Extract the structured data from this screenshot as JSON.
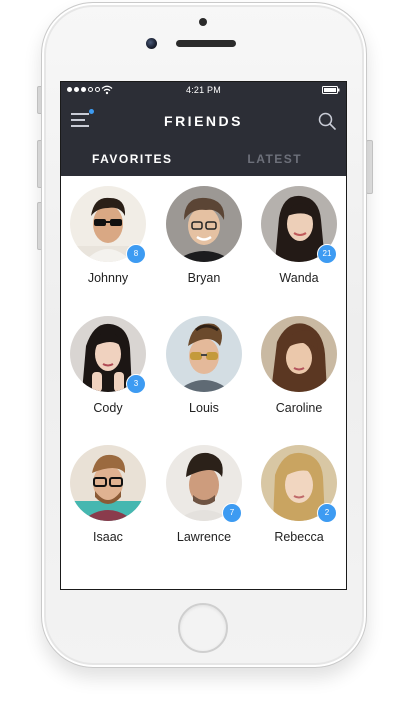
{
  "status_bar": {
    "time": "4:21 PM"
  },
  "header": {
    "title": "FRIENDS",
    "menu_icon": "menu-icon",
    "search_icon": "search-icon",
    "has_notification_dot": true
  },
  "tabs": [
    {
      "label": "FAVORITES",
      "active": true
    },
    {
      "label": "LATEST",
      "active": false
    }
  ],
  "friends": [
    {
      "name": "Johnny",
      "badge": "8"
    },
    {
      "name": "Bryan",
      "badge": ""
    },
    {
      "name": "Wanda",
      "badge": "21"
    },
    {
      "name": "Cody",
      "badge": "3"
    },
    {
      "name": "Louis",
      "badge": ""
    },
    {
      "name": "Caroline",
      "badge": ""
    },
    {
      "name": "Isaac",
      "badge": ""
    },
    {
      "name": "Lawrence",
      "badge": "7"
    },
    {
      "name": "Rebecca",
      "badge": "2"
    }
  ],
  "colors": {
    "header_bg": "#2c2e36",
    "badge_blue": "#3d9bf2",
    "inactive_tab": "#6d707a"
  }
}
